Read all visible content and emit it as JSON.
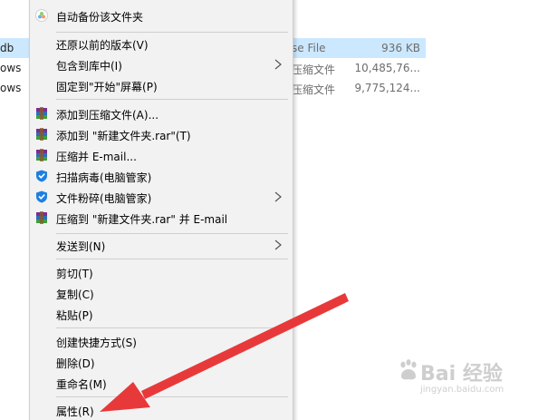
{
  "explorer": {
    "rows": [
      {
        "name": "db",
        "type": "se File",
        "size": "936 KB",
        "selected": true
      },
      {
        "name": "ows",
        "type": "压缩文件",
        "size": "10,485,76...",
        "selected": false
      },
      {
        "name": "ows",
        "type": "压缩文件",
        "size": "9,775,124...",
        "selected": false
      }
    ]
  },
  "context_menu": {
    "items": [
      {
        "label": "自动备份该文件夹",
        "icon": "cloud-backup-icon",
        "submenu": false
      },
      {
        "label": "还原以前的版本(V)",
        "icon": "",
        "submenu": false
      },
      {
        "label": "包含到库中(I)",
        "icon": "",
        "submenu": true
      },
      {
        "label": "固定到\"开始\"屏幕(P)",
        "icon": "",
        "submenu": false
      },
      {
        "label": "添加到压缩文件(A)...",
        "icon": "winrar-icon",
        "submenu": false
      },
      {
        "label": "添加到 \"新建文件夹.rar\"(T)",
        "icon": "winrar-icon",
        "submenu": false
      },
      {
        "label": "压缩并 E-mail...",
        "icon": "winrar-icon",
        "submenu": false
      },
      {
        "label": "扫描病毒(电脑管家)",
        "icon": "shield-icon",
        "submenu": false
      },
      {
        "label": "文件粉碎(电脑管家)",
        "icon": "shield-icon",
        "submenu": true
      },
      {
        "label": "压缩到 \"新建文件夹.rar\" 并 E-mail",
        "icon": "winrar-icon",
        "submenu": false
      },
      {
        "label": "发送到(N)",
        "icon": "",
        "submenu": true
      },
      {
        "label": "剪切(T)",
        "icon": "",
        "submenu": false
      },
      {
        "label": "复制(C)",
        "icon": "",
        "submenu": false
      },
      {
        "label": "粘贴(P)",
        "icon": "",
        "submenu": false
      },
      {
        "label": "创建快捷方式(S)",
        "icon": "",
        "submenu": false
      },
      {
        "label": "删除(D)",
        "icon": "",
        "submenu": false
      },
      {
        "label": "重命名(M)",
        "icon": "",
        "submenu": false
      },
      {
        "label": "属性(R)",
        "icon": "",
        "submenu": false
      }
    ]
  },
  "annotation": {
    "color": "#e8393a",
    "icon": "red-arrow-icon"
  },
  "watermark": {
    "text": "Bai 经验",
    "url": "jingyan.baidu.com",
    "icon": "baidu-paw-logo-icon"
  }
}
